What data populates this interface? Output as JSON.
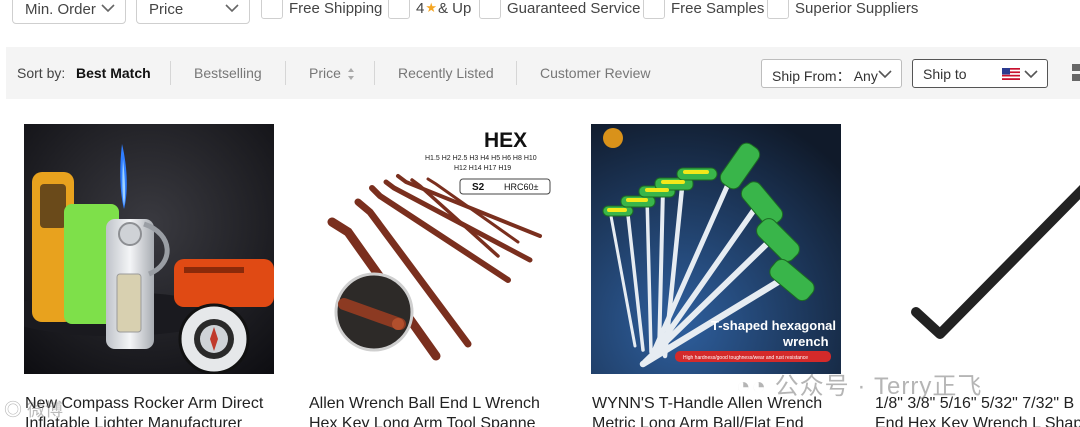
{
  "filters": {
    "min_order": "Min. Order",
    "price": "Price",
    "checkboxes": [
      {
        "label": "Free Shipping"
      },
      {
        "label_pre": "4",
        "label_post": "& Up"
      },
      {
        "label": "Guaranteed Service"
      },
      {
        "label": "Free Samples"
      },
      {
        "label": "Superior Suppliers"
      }
    ]
  },
  "sort": {
    "label": "Sort by:",
    "options": [
      "Best Match",
      "Bestselling",
      "Price",
      "Recently Listed",
      "Customer Review"
    ],
    "active": "Best Match",
    "ship_from": "Ship From： Any",
    "ship_to": "Ship to"
  },
  "products": [
    {
      "title_line1": "New Compass Rocker Arm Direct",
      "title_line2": "Inflatable Lighter Manufacturer"
    },
    {
      "title_line1": "Allen Wrench Ball End L Wrench",
      "title_line2": "Hex Key Long Arm Tool Spanne",
      "image_text": {
        "hex": "HEX",
        "sizes1": "H1.5 H2 H2.5 H3 H4 H5 H6 H8 H10",
        "sizes2": "H12 H14 H17 H19",
        "badge_s2": "S2",
        "badge_hrc": "HRC60±"
      }
    },
    {
      "title_line1": "WYNN'S T-Handle Allen Wrench",
      "title_line2": "Metric Long Arm Ball/Flat End",
      "image_text": {
        "caption1": "T-shaped hexagonal",
        "caption2": "wrench",
        "sub": "High hardness/good toughness/wear and rust resistance"
      }
    },
    {
      "title_line1": "1/8\" 3/8\" 5/16\" 5/32\" 7/32\" B",
      "title_line2": "End Hex Key Wrench L Shap"
    }
  ],
  "watermark": "公众号 · Terry正飞",
  "watermark2": "微博"
}
